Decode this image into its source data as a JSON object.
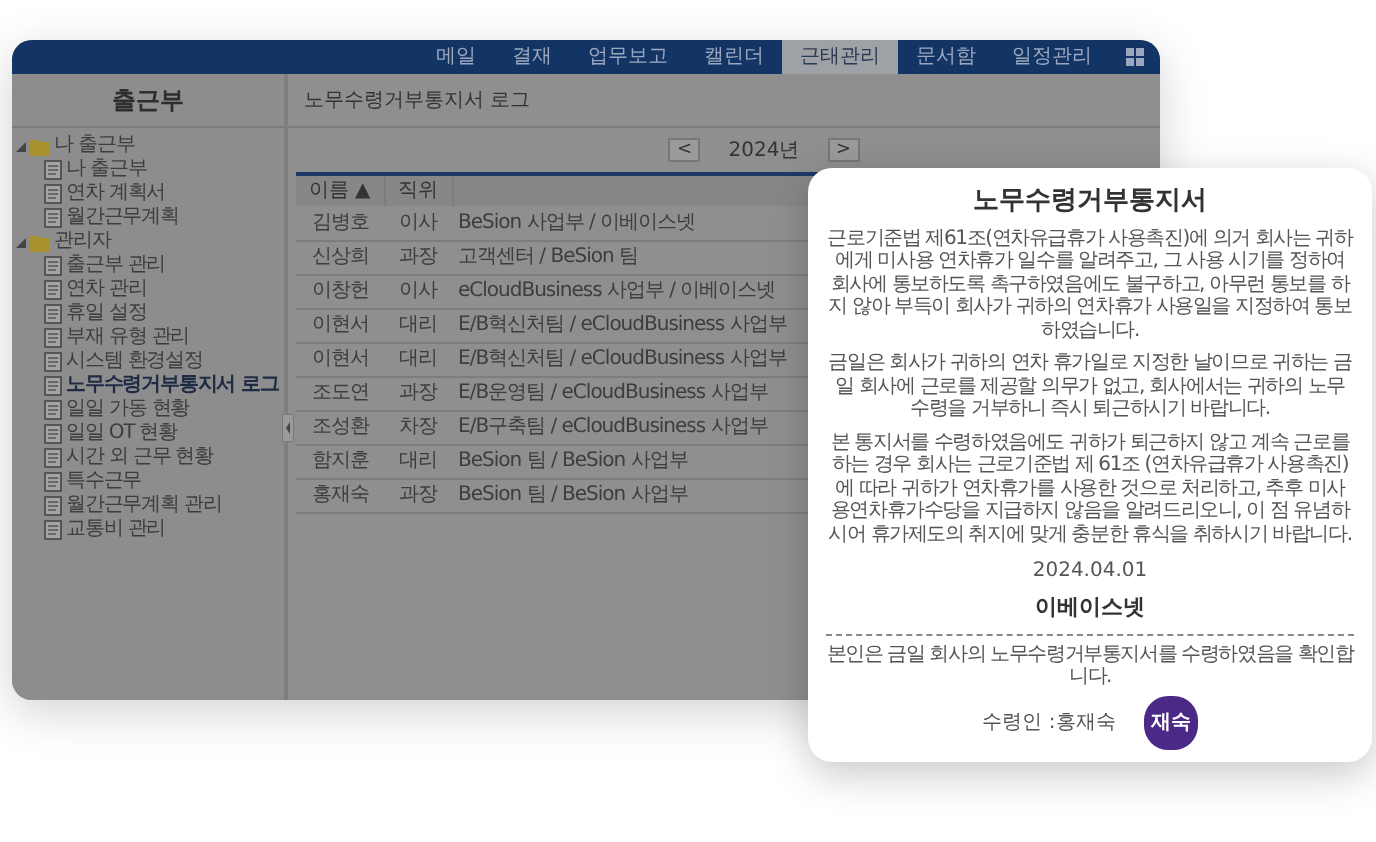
{
  "nav": {
    "items": [
      {
        "label": "메일",
        "selected": false
      },
      {
        "label": "결재",
        "selected": false
      },
      {
        "label": "업무보고",
        "selected": false
      },
      {
        "label": "캘린더",
        "selected": false
      },
      {
        "label": "근태관리",
        "selected": true
      },
      {
        "label": "문서함",
        "selected": false
      },
      {
        "label": "일정관리",
        "selected": false
      }
    ]
  },
  "sidebar": {
    "title": "출근부",
    "tree": [
      {
        "label": "나 출근부",
        "kind": "folder",
        "expanded": true,
        "children": [
          {
            "label": "나 출근부",
            "kind": "page",
            "selected": false
          },
          {
            "label": "연차 계획서",
            "kind": "page",
            "selected": false
          },
          {
            "label": "월간근무계획",
            "kind": "page",
            "selected": false
          }
        ]
      },
      {
        "label": "관리자",
        "kind": "folder",
        "expanded": true,
        "children": [
          {
            "label": "출근부 관리",
            "kind": "page",
            "selected": false
          },
          {
            "label": "연차 관리",
            "kind": "page",
            "selected": false
          },
          {
            "label": "휴일 설정",
            "kind": "page",
            "selected": false
          },
          {
            "label": "부재 유형 관리",
            "kind": "page",
            "selected": false
          },
          {
            "label": "시스템 환경설정",
            "kind": "page",
            "selected": false
          },
          {
            "label": "노무수령거부통지서 로그",
            "kind": "page",
            "selected": true
          },
          {
            "label": "일일 가동 현황",
            "kind": "page",
            "selected": false
          },
          {
            "label": "일일 OT 현황",
            "kind": "page",
            "selected": false
          },
          {
            "label": "시간 외 근무 현황",
            "kind": "page",
            "selected": false
          },
          {
            "label": "특수근무",
            "kind": "page",
            "selected": false
          },
          {
            "label": "월간근무계획 관리",
            "kind": "page",
            "selected": false
          },
          {
            "label": "교통비 관리",
            "kind": "page",
            "selected": false
          }
        ]
      }
    ]
  },
  "breadcrumb": "노무수령거부통지서 로그",
  "year_nav": {
    "prev": "<",
    "label": "2024년",
    "next": ">"
  },
  "table": {
    "columns": [
      {
        "label": "이름",
        "sort_icon": "▲"
      },
      {
        "label": "직위"
      }
    ],
    "rows": [
      {
        "name": "김병호",
        "position": "이사",
        "department": "BeSion 사업부 / 이베이스넷"
      },
      {
        "name": "신상희",
        "position": "과장",
        "department": "고객센터 / BeSion 팀"
      },
      {
        "name": "이창헌",
        "position": "이사",
        "department": "eCloudBusiness 사업부 / 이베이스넷"
      },
      {
        "name": "이현서",
        "position": "대리",
        "department": "E/B혁신처팀 / eCloudBusiness 사업부"
      },
      {
        "name": "이현서",
        "position": "대리",
        "department": "E/B혁신처팀 / eCloudBusiness 사업부"
      },
      {
        "name": "조도연",
        "position": "과장",
        "department": "E/B운영팀 / eCloudBusiness 사업부"
      },
      {
        "name": "조성환",
        "position": "차장",
        "department": "E/B구축팀 / eCloudBusiness 사업부"
      },
      {
        "name": "함지훈",
        "position": "대리",
        "department": "BeSion 팀 / BeSion 사업부"
      },
      {
        "name": "홍재숙",
        "position": "과장",
        "department": "BeSion 팀 / BeSion 사업부"
      }
    ]
  },
  "notice": {
    "title": "노무수령거부통지서",
    "paragraphs": [
      "근로기준법 제61조(연차유급휴가 사용촉진)에 의거 회사는 귀하에게 미사용 연차휴가 일수를 알려주고, 그 사용 시기를 정하여 회사에 통보하도록 촉구하였음에도 불구하고, 아무런 통보를 하지 않아 부득이 회사가 귀하의 연차휴가 사용일을 지정하여 통보하였습니다.",
      "금일은 회사가 귀하의 연차 휴가일로 지정한 날이므로 귀하는 금일 회사에 근로를 제공할 의무가 없고, 회사에서는 귀하의 노무수령을 거부하니 즉시 퇴근하시기 바랍니다.",
      "본 통지서를 수령하였음에도 귀하가 퇴근하지 않고 계속 근로를 하는 경우 회사는 근로기준법 제 61조 (연차유급휴가 사용촉진)에 따라 귀하가 연차휴가를 사용한 것으로 처리하고, 추후 미사용연차휴가수당을 지급하지 않음을 알려드리오니, 이 점 유념하시어 휴가제도의 취지에 맞게 충분한 휴식을 취하시기 바랍니다."
    ],
    "date": "2024.04.01",
    "company": "이베이스넷",
    "confirmation": "본인은 금일 회사의 노무수령거부통지서를 수령하였음을 확인합니다.",
    "recipient": "수령인 :홍재숙",
    "seal": "재숙"
  }
}
